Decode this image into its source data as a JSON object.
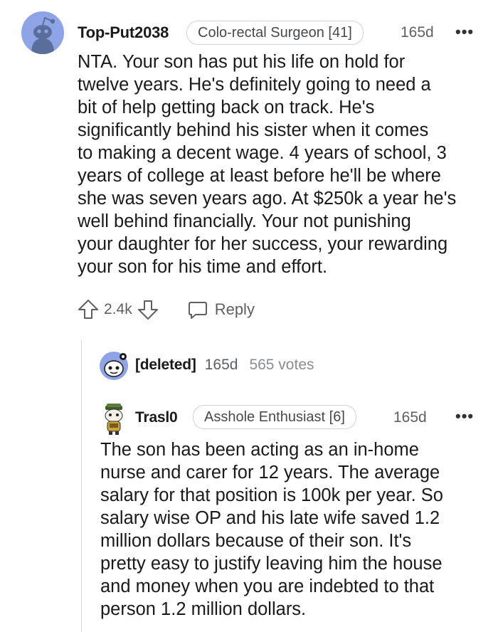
{
  "comment": {
    "username": "Top-Put2038",
    "flair": "Colo-rectal Surgeon [41]",
    "time": "165d",
    "more": "•••",
    "body": "NTA. Your son has put his life on hold for\ntwelve years. He's definitely going to need a\nbit of help getting back on track. He's\nsignificantly behind his sister when it comes\nto making a decent wage. 4 years of school, 3\nyears of college at least before he'll be where\nshe was seven years ago. At $250k a year he's\nwell behind financially. Your not punishing\nyour daughter for her success, your rewarding\nyour son for his time and effort.",
    "votes": "2.4k",
    "reply_label": "Reply"
  },
  "deleted_comment": {
    "username": "[deleted]",
    "time": "165d",
    "votes": "565 votes"
  },
  "reply": {
    "username": "Trasl0",
    "flair": "Asshole Enthusiast [6]",
    "time": "165d",
    "more": "•••",
    "body": "The son has been acting as an in-home\nnurse and carer for 12 years. The average\nsalary for that position is 100k per year. So\nsalary wise OP and his late wife saved 1.2\nmillion dollars because of their son. It's\npretty easy to justify leaving him the house\nand money when you are indebted to that\nperson 1.2 million dollars."
  },
  "colors": {
    "avatar_bg": "#8ea4e6",
    "text": "#1a1a1b",
    "meta": "#5d6062",
    "flair_border": "#cfd2d4"
  },
  "icons": [
    "snoo-avatar-icon",
    "more-icon",
    "upvote-icon",
    "downvote-icon",
    "reply-icon",
    "deleted-avatar-icon",
    "user-avatar-icon"
  ]
}
